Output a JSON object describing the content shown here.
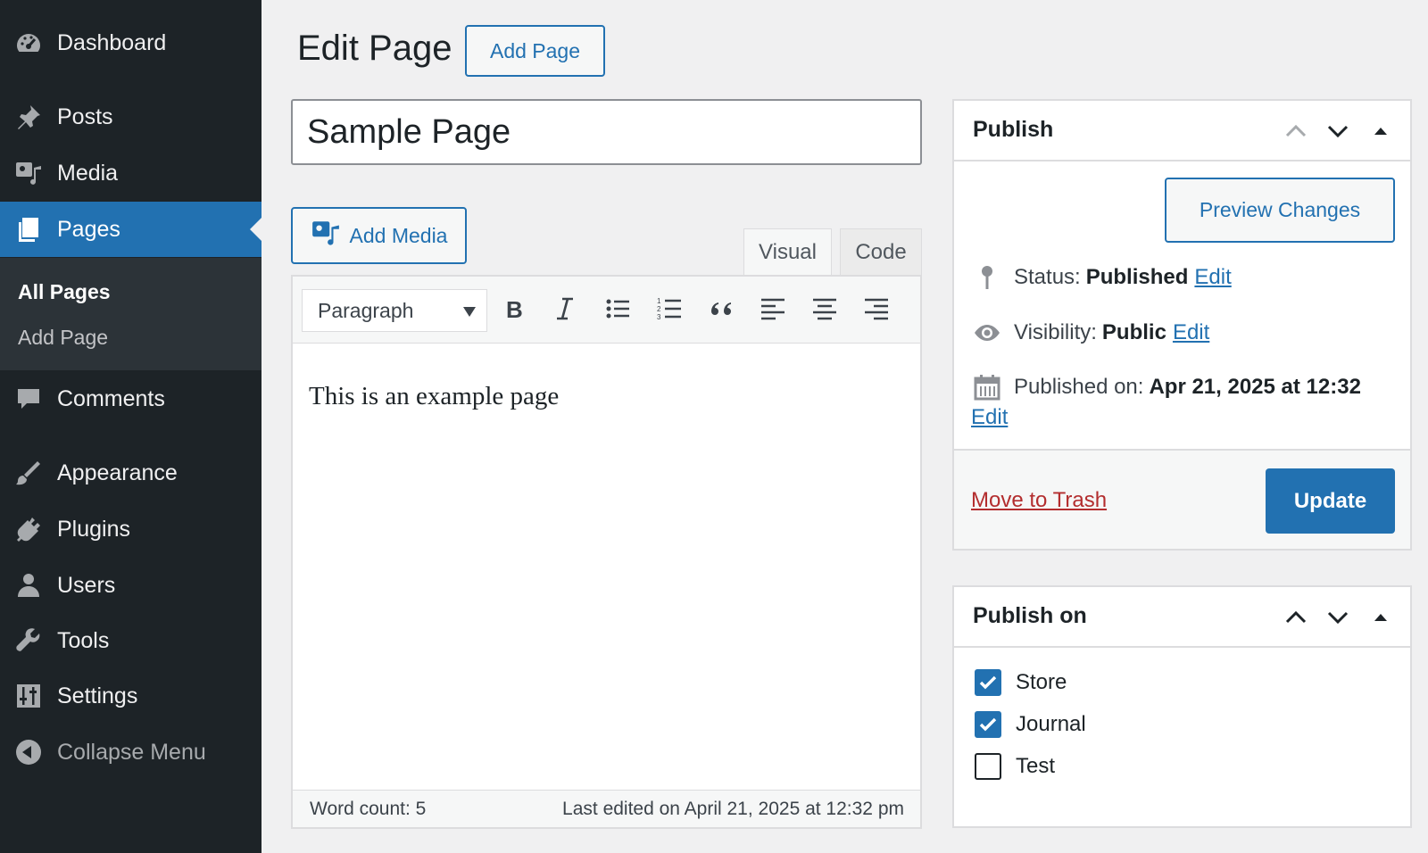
{
  "sidebar": {
    "items": [
      {
        "label": "Dashboard",
        "icon": "dashboard-icon"
      },
      {
        "label": "Posts",
        "icon": "pin-icon"
      },
      {
        "label": "Media",
        "icon": "media-icon"
      },
      {
        "label": "Pages",
        "icon": "pages-icon",
        "current": true
      },
      {
        "label": "Comments",
        "icon": "comment-icon"
      },
      {
        "label": "Appearance",
        "icon": "brush-icon"
      },
      {
        "label": "Plugins",
        "icon": "plugin-icon"
      },
      {
        "label": "Users",
        "icon": "user-icon"
      },
      {
        "label": "Tools",
        "icon": "wrench-icon"
      },
      {
        "label": "Settings",
        "icon": "settings-icon"
      }
    ],
    "submenu": [
      {
        "label": "All Pages",
        "current": true
      },
      {
        "label": "Add Page"
      }
    ],
    "collapse_label": "Collapse Menu"
  },
  "header": {
    "title": "Edit Page",
    "add_page_label": "Add Page"
  },
  "editor": {
    "title_value": "Sample Page",
    "add_media_label": "Add Media",
    "tabs": [
      "Visual",
      "Code"
    ],
    "active_tab": "Visual",
    "format_select_value": "Paragraph",
    "toolbar_buttons": [
      "bold-icon",
      "italic-icon",
      "bullet-list-icon",
      "numbered-list-icon",
      "blockquote-icon",
      "align-left-icon",
      "align-center-icon",
      "align-right-icon"
    ],
    "content": "This is an example page",
    "word_count": "Word count: 5",
    "last_edited": "Last edited on April 21, 2025 at 12:32 pm"
  },
  "publish": {
    "title": "Publish",
    "preview_label": "Preview Changes",
    "status_label": "Status:",
    "status_value": "Published",
    "visibility_label": "Visibility:",
    "visibility_value": "Public",
    "published_label": "Published on:",
    "published_value": "Apr 21, 2025 at 12:32",
    "edit_label": "Edit",
    "trash_label": "Move to Trash",
    "update_label": "Update"
  },
  "publish_on": {
    "title": "Publish on",
    "options": [
      {
        "label": "Store",
        "checked": true
      },
      {
        "label": "Journal",
        "checked": true
      },
      {
        "label": "Test",
        "checked": false
      }
    ]
  },
  "colors": {
    "sidebar_bg": "#1d2327",
    "accent": "#2271b1",
    "trash": "#b32d2e"
  }
}
